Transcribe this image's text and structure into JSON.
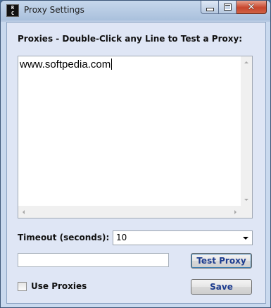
{
  "window": {
    "title": "Proxy Settings",
    "icon": "rc-app-icon",
    "icon_letters": [
      "R",
      "C"
    ],
    "close_glyph": "✕"
  },
  "proxies": {
    "label": "Proxies - Double-Click any Line to Test a Proxy:",
    "text": "www.softpedia.com"
  },
  "timeout": {
    "label": "Timeout (seconds):",
    "selected": "10"
  },
  "test": {
    "input_value": "",
    "button_label": "Test Proxy"
  },
  "use_proxies": {
    "label": "Use Proxies",
    "checked": false
  },
  "save": {
    "button_label": "Save"
  },
  "colors": {
    "button_text": "#1e3d8f",
    "client_bg": "#dfe6f5",
    "close_button": "#c7462c"
  }
}
